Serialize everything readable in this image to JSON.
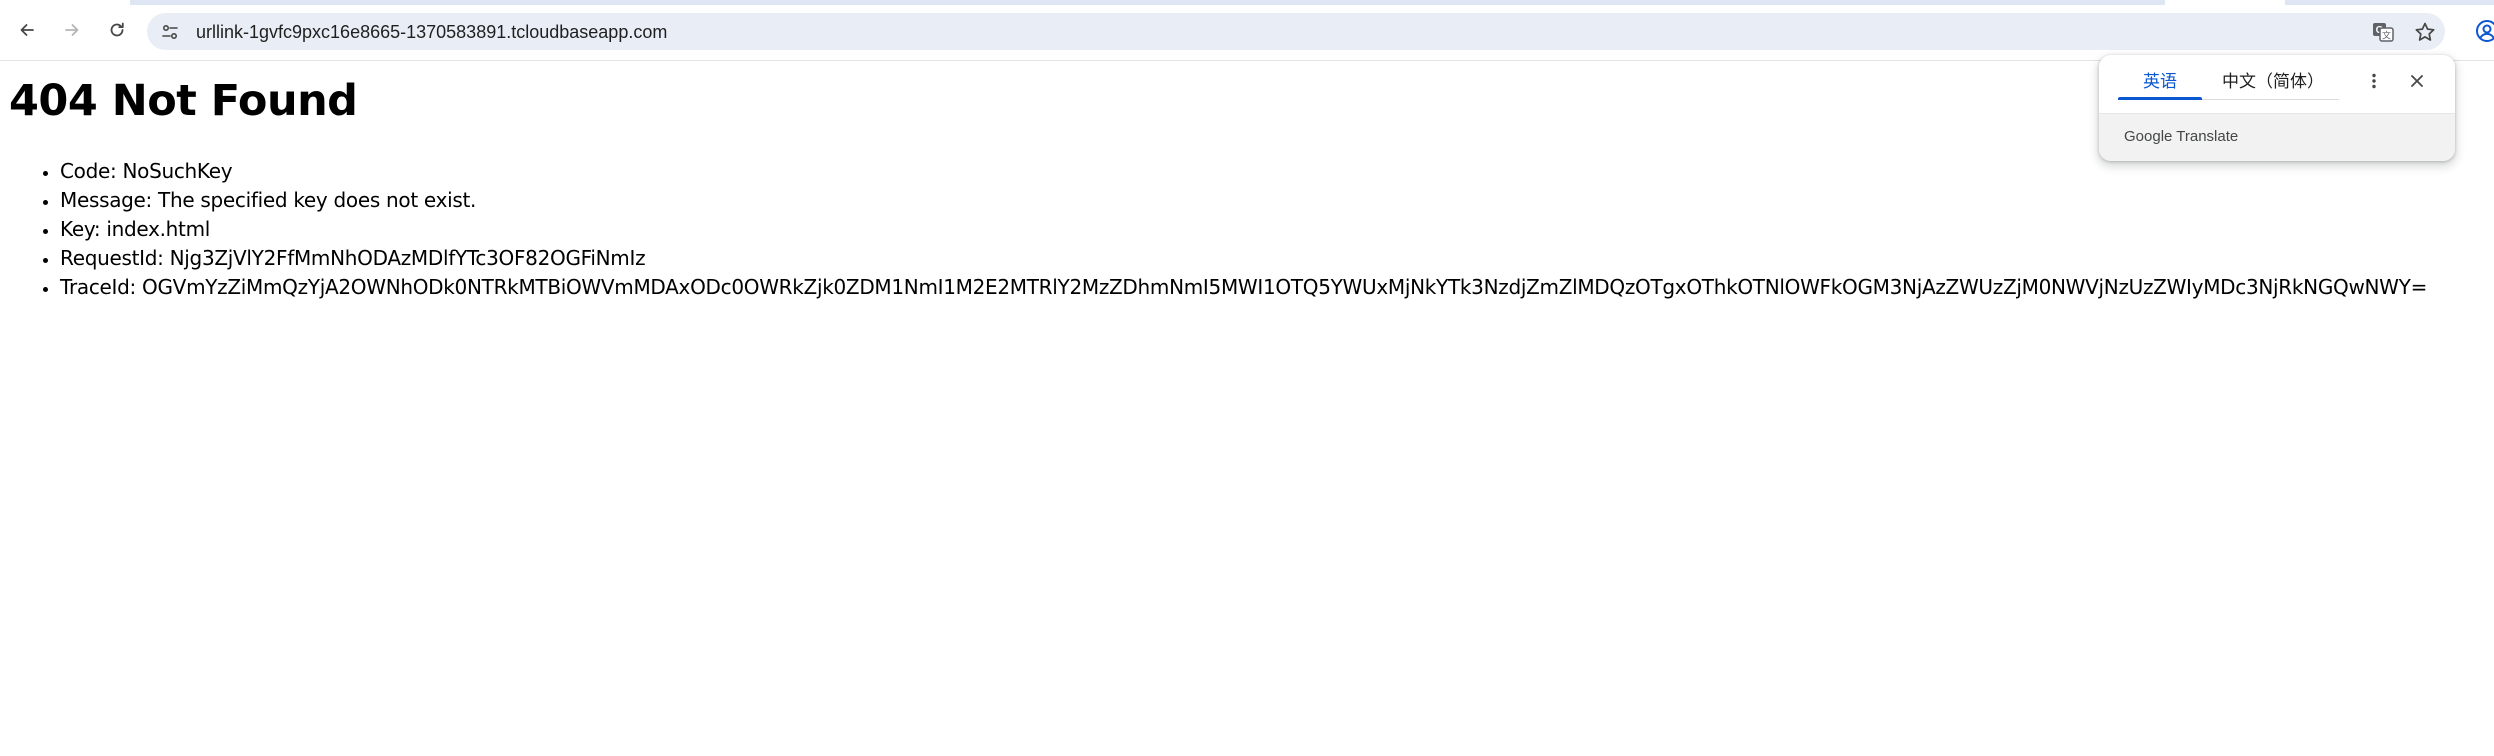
{
  "browser": {
    "url": "urllink-1gvfc9pxc16e8665-1370583891.tcloudbaseapp.com",
    "icons": {
      "back": "arrow-left-icon",
      "forward": "arrow-right-icon",
      "reload": "reload-icon",
      "site_info": "tune-icon",
      "translate": "translate-icon",
      "bookmark": "star-icon",
      "profile": "profile-icon"
    }
  },
  "page": {
    "title": "404 Not Found",
    "items": [
      "Code: NoSuchKey",
      "Message: The specified key does not exist.",
      "Key: index.html",
      "RequestId: Njg3ZjVlY2FfMmNhODAzMDlfYTc3OF82OGFiNmIz",
      "TraceId: OGVmYzZiMmQzYjA2OWNhODk0NTRkMTBiOWVmMDAxODc0OWRkZjk0ZDM1NmI1M2E2MTRlY2MzZDhmNmI5MWI1OTQ5YWUxMjNkYTk3NzdjZmZlMDQzOTgxOThkOTNlOWFkOGM3NjAzZWUzZjM0NWVjNzUzZWIyMDc3NjRkNGQwNWY="
    ]
  },
  "translate_popup": {
    "tabs": [
      "英语",
      "中文（简体）"
    ],
    "active_tab": 0,
    "footer": "Google Translate",
    "accent_color": "#0b57d0"
  }
}
